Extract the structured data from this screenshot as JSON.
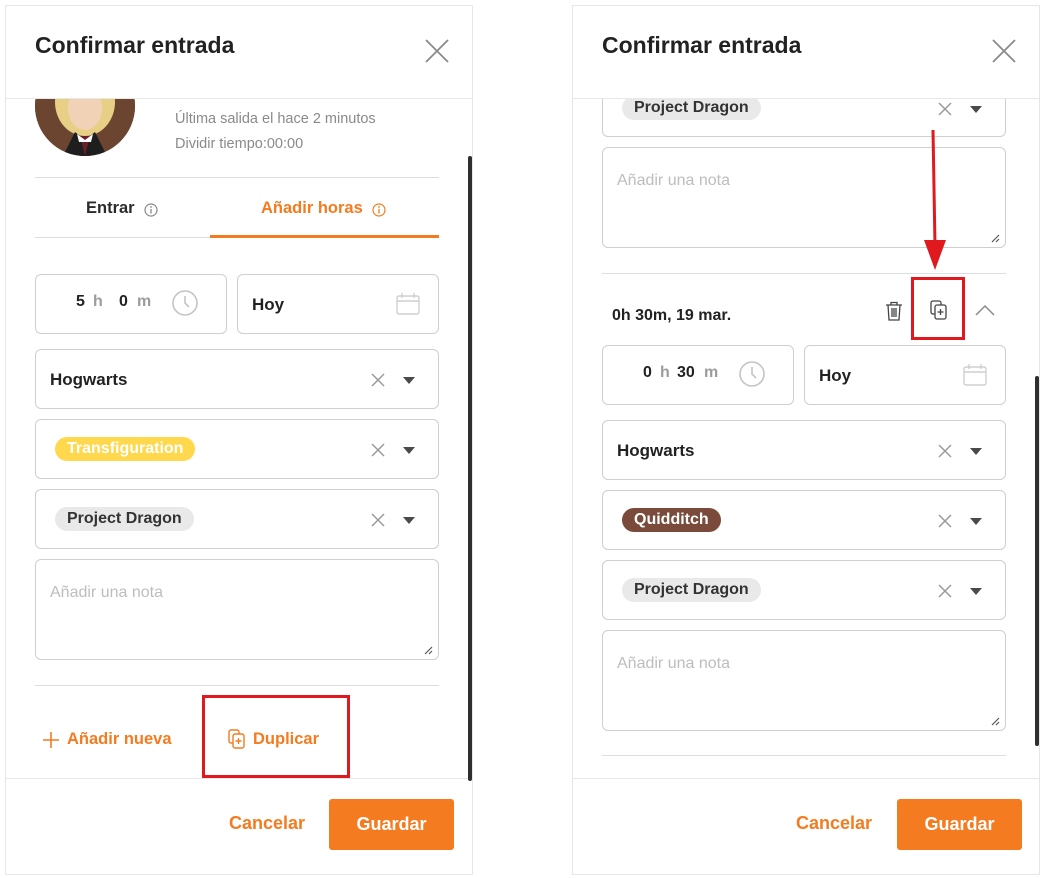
{
  "left": {
    "title": "Confirmar entrada",
    "last_out": "Última salida el hace 2 minutos",
    "split": "Dividir tiempo:00:00",
    "tabs": [
      "Entrar",
      "Añadir horas"
    ],
    "hours": "5",
    "hours_unit": "h",
    "minutes": "0",
    "minutes_unit": "m",
    "date": "Hoy",
    "client": "Hogwarts",
    "project": "Transfiguration",
    "task": "Project Dragon",
    "note_placeholder": "Añadir una nota",
    "add_new": "Añadir nueva",
    "duplicate": "Duplicar",
    "cancel": "Cancelar",
    "save": "Guardar"
  },
  "right": {
    "title": "Confirmar entrada",
    "top_task": "Project Dragon",
    "top_note_placeholder": "Añadir una nota",
    "entry_summary": "0h 30m, 19 mar.",
    "hours": "0",
    "hours_unit": "h",
    "minutes": "30",
    "minutes_unit": "m",
    "date": "Hoy",
    "client": "Hogwarts",
    "project": "Quidditch",
    "task": "Project Dragon",
    "note_placeholder": "Añadir una nota",
    "cancel": "Cancelar",
    "save": "Guardar"
  },
  "colors": {
    "accent": "#f47b20",
    "highlight": "#e0191f",
    "tag_transfiguration": "#ffd84d",
    "tag_quidditch": "#7a4b3a",
    "tag_project": "#e9e9e9"
  },
  "icons": [
    "close-icon",
    "info-icon",
    "clock-icon",
    "calendar-icon",
    "clear-icon",
    "caret-down-icon",
    "plus-icon",
    "duplicate-icon",
    "trash-icon",
    "chevron-up-icon",
    "resize-icon"
  ]
}
